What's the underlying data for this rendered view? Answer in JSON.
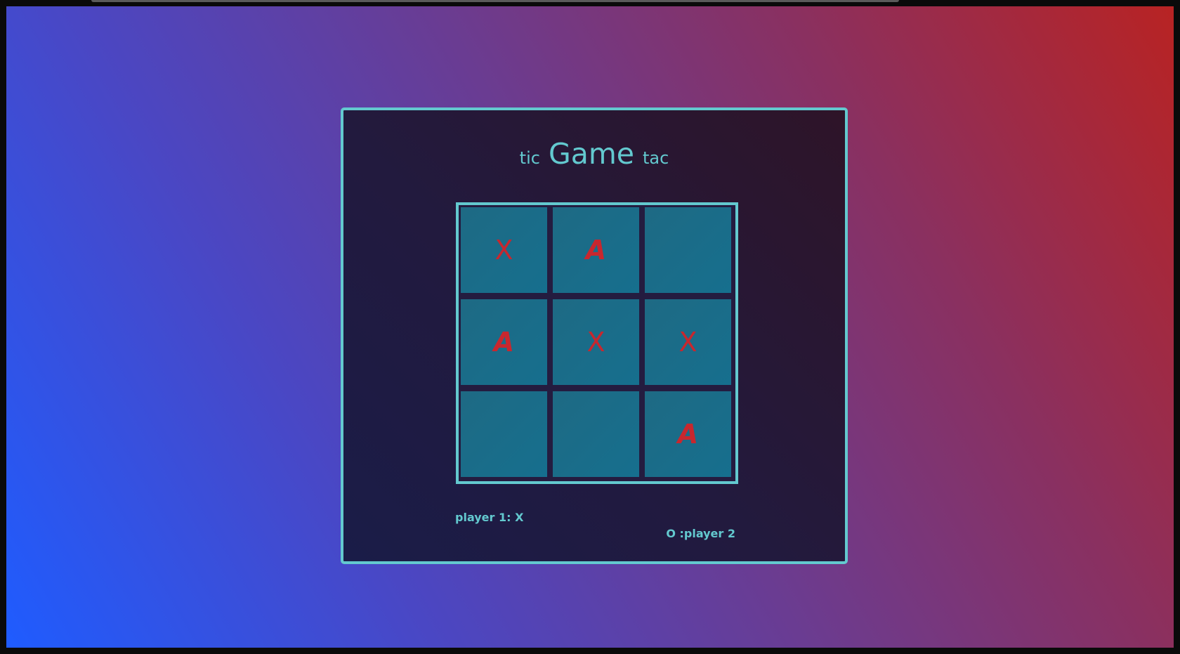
{
  "game": {
    "title_left": "tic",
    "title_main": "Game",
    "title_right": "tac",
    "board": [
      [
        "X",
        "A",
        ""
      ],
      [
        "A",
        "X",
        "X"
      ],
      [
        "",
        "",
        "A"
      ]
    ],
    "player1_label": "player 1: X",
    "player2_label": "O :player 2"
  },
  "colors": {
    "accent": "#63c9cf",
    "mark": "#c8272e",
    "cell": "#166f8e"
  }
}
